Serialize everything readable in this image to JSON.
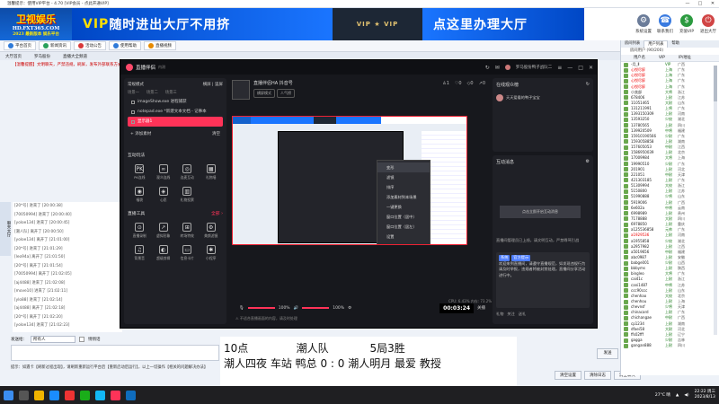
{
  "window": {
    "title": "温馨提示：使用VIP平台 - 4.70 [VIP会员 - 点此开通VIP]",
    "controls": [
      "—",
      "□",
      "✕"
    ]
  },
  "banner": {
    "logo": {
      "l1": "卫视娱乐",
      "l2": "HD.FXT365.COM",
      "l3": "2023 最新版本 娱乐平台"
    },
    "ad1": {
      "pre": "VIP",
      "text": "随时进出大厅不用挤"
    },
    "ad2": {
      "text": "VIP ★ VIP"
    },
    "ad3": {
      "pre": "",
      "text": "点这里办理大厅"
    },
    "icons": [
      {
        "label": "系统设置",
        "color": "#6b7c99",
        "glyph": "⚙"
      },
      {
        "label": "联系我们",
        "color": "#3a7be0",
        "glyph": "☎"
      },
      {
        "label": "充值VIP",
        "color": "#2b9a3f",
        "glyph": "$"
      },
      {
        "label": "退出大厅",
        "color": "#d14545",
        "glyph": "⏻"
      }
    ]
  },
  "toolbar": {
    "items": [
      {
        "label": "平台首页",
        "color": "#2f7ad8"
      },
      {
        "label": "新闻资讯",
        "color": "#2aa05a"
      },
      {
        "label": "活动公告",
        "color": "#d83a3a"
      },
      {
        "label": "使用帮助",
        "color": "#2f7ad8"
      },
      {
        "label": "直播视频",
        "color": "#e68a00"
      }
    ]
  },
  "crumb": {
    "items": [
      "大厅首页",
      "罗马股份",
      "直播大全频道"
    ]
  },
  "notice": "【温馨提醒】文明聊天，严禁违规，刷屏，发布外部联系方式违者封号",
  "lefttab": "聊天大厅",
  "chatlog": [
    "[20*号] 进来了 [20:00:38]",
    "[70050994] 进来了 [20:00:40]",
    "[yoloe134] 进来了 [20:00:45]",
    "[潮人队] 离开了 [20:00:50]",
    "[yoloe134] 离开了 [21:01:00]",
    "[20*号] 进来了 [21:01:29]",
    "[leo94a] 离开了 [21:01:50]",
    "[20*号] 离开了 [21:01:54]",
    "[70050994] 离开了 [21:02:05]",
    "[aj4488] 进来了 [21:02:08]",
    "[move10] 进来了 [21:02:11]",
    "[ylo88] 进来了 [21:02:14]",
    "[aj4488] 离开了 [21:02:18]",
    "[20*号] 离开了 [21:02:20]",
    "[yoloe134] 进来了 [21:02:23]"
  ],
  "input": {
    "label": "发送给：",
    "target": "所有人",
    "checkbox": "悄悄话",
    "send": "发送"
  },
  "tip": "提示：如遇卡【刷新过程出现】，请刷新重新运行平台后【重新启动后运行】，以上一切操作【相关的问题解决办法】",
  "overlay": {
    "line1": "10点              潮人队            5局3胜",
    "line2": "潮人四夜 车站 鸭总 0 : 0 潮人明月 最爱 教授"
  },
  "rightbuttons": [
    "清空设置",
    "清除日志",
    "清空聊天"
  ],
  "rpanel": {
    "tabs": [
      "房间列表",
      "用户列表",
      "帮助"
    ],
    "active": 1,
    "sub": "房间用户 (90/200)",
    "headers": [
      "用户名",
      "VIP",
      "IP/地址"
    ],
    "users": [
      {
        "n": "-月_Ⅱ",
        "r": "VIP",
        "ip": "广西",
        "red": false
      },
      {
        "n": "心悦尽醉",
        "r": "上海",
        "ip": "广东",
        "red": true
      },
      {
        "n": "心悦尽醉",
        "r": "上海",
        "ip": "广东",
        "red": true
      },
      {
        "n": "心悦尽醉",
        "r": "上海",
        "ip": "广东",
        "red": true
      },
      {
        "n": "心悦尽醉",
        "r": "上海",
        "ip": "广东",
        "red": true
      },
      {
        "n": "小卖部",
        "r": "大将",
        "ip": "浙江",
        "red": false
      },
      {
        "n": "678406",
        "r": "上尉",
        "ip": "江苏",
        "red": false
      },
      {
        "n": "11051465",
        "r": "大尉",
        "ip": "山东",
        "red": false
      },
      {
        "n": "131211991",
        "r": "上将",
        "ip": "广东",
        "red": false
      },
      {
        "n": "1393150309",
        "r": "上尉",
        "ip": "河南",
        "red": false
      },
      {
        "n": "13593250",
        "r": "少校",
        "ip": "湖北",
        "red": false
      },
      {
        "n": "13780565",
        "r": "上尉",
        "ip": "四川",
        "red": false
      },
      {
        "n": "139920509",
        "r": "中将",
        "ip": "福建",
        "red": false
      },
      {
        "n": "15910190566",
        "r": "少尉",
        "ip": "广东",
        "red": false
      },
      {
        "n": "1593058858",
        "r": "上尉",
        "ip": "湖南",
        "red": false
      },
      {
        "n": "157605053",
        "r": "中尉",
        "ip": "江西",
        "red": false
      },
      {
        "n": "1586950039",
        "r": "上尉",
        "ip": "北京",
        "red": false
      },
      {
        "n": "17009984",
        "r": "大将",
        "ip": "上海",
        "red": false
      },
      {
        "n": "19990510",
        "r": "少尉",
        "ip": "广东",
        "red": false
      },
      {
        "n": "201901",
        "r": "上尉",
        "ip": "河北",
        "red": false
      },
      {
        "n": "221051",
        "r": "中尉",
        "ip": "天津",
        "red": false
      },
      {
        "n": "421303185",
        "r": "上尉",
        "ip": "广东",
        "red": false
      },
      {
        "n": "51309994",
        "r": "大校",
        "ip": "浙江",
        "red": false
      },
      {
        "n": "5150800",
        "r": "上尉",
        "ip": "江苏",
        "red": false
      },
      {
        "n": "51990888",
        "r": "少将",
        "ip": "山东",
        "red": false
      },
      {
        "n": "5919006",
        "r": "上尉",
        "ip": "广西",
        "red": false
      },
      {
        "n": "6e602a",
        "r": "中将",
        "ip": "云南",
        "red": false
      },
      {
        "n": "6998989",
        "r": "上尉",
        "ip": "贵州",
        "red": false
      },
      {
        "n": "7178888",
        "r": "大尉",
        "ip": "四川",
        "red": false
      },
      {
        "n": "6978850",
        "r": "上尉",
        "ip": "重庆",
        "red": false
      },
      {
        "n": "a125536858",
        "r": "元帅",
        "ip": "广东",
        "red": false
      },
      {
        "n": "a1929536",
        "r": "上尉",
        "ip": "河南",
        "red": true
      },
      {
        "n": "a1955858",
        "r": "少校",
        "ip": "湖北",
        "red": false
      },
      {
        "n": "a2957982",
        "r": "上尉",
        "ip": "江西",
        "red": false
      },
      {
        "n": "a5019656",
        "r": "中尉",
        "ip": "福建",
        "red": false
      },
      {
        "n": "abc0987",
        "r": "上尉",
        "ip": "安徽",
        "red": false
      },
      {
        "n": "babge001",
        "r": "少尉",
        "ip": "山西",
        "red": false
      },
      {
        "n": "bbbyms",
        "r": "上尉",
        "ip": "陕西",
        "red": false
      },
      {
        "n": "bingleo",
        "r": "大将",
        "ip": "广东",
        "red": false
      },
      {
        "n": "cai41c",
        "r": "上尉",
        "ip": "浙江",
        "red": false
      },
      {
        "n": "cani1487",
        "r": "中将",
        "ip": "江苏",
        "red": false
      },
      {
        "n": "ccc90ccc",
        "r": "上尉",
        "ip": "山东",
        "red": false
      },
      {
        "n": "chenhao",
        "r": "大校",
        "ip": "北京",
        "red": false
      },
      {
        "n": "chenhou",
        "r": "上尉",
        "ip": "上海",
        "red": false
      },
      {
        "n": "chevnsf",
        "r": "少将",
        "ip": "天津",
        "red": false
      },
      {
        "n": "chinacard",
        "r": "上尉",
        "ip": "广东",
        "red": false
      },
      {
        "n": "chichangae",
        "r": "中尉",
        "ip": "广西",
        "red": false
      },
      {
        "n": "cp1234",
        "r": "上尉",
        "ip": "湖南",
        "red": false
      },
      {
        "n": "dfaei58",
        "r": "大尉",
        "ip": "河北",
        "red": false
      },
      {
        "n": "ffs02fff",
        "r": "上尉",
        "ip": "辽宁",
        "red": false
      },
      {
        "n": "gagga",
        "r": "少尉",
        "ip": "吉林",
        "red": false
      },
      {
        "n": "gangan888",
        "r": "上尉",
        "ip": "四川",
        "red": false
      }
    ]
  },
  "obs": {
    "appname": "直播伴侣",
    "badge": "内测",
    "user": "罗马股份鸭子战队二",
    "mode": "常规模式",
    "scenes": [
      "横屏",
      "竖屏"
    ],
    "layerTabs": [
      "场景一",
      "场景二",
      "场景三"
    ],
    "sources": [
      {
        "label": "imageShow.exe 进程捕获",
        "on": false
      },
      {
        "label": "notepad.exe *新建文本文档 - 记事本",
        "on": false
      },
      {
        "label": "显示器1",
        "on": true
      }
    ],
    "addsource": "+ 添加素材",
    "clear": "清空",
    "interactTitle": "互动玩法",
    "interact": [
      {
        "g": "PK",
        "t": "PK连线"
      },
      {
        "g": "∞",
        "t": "观众连线"
      },
      {
        "g": "◎",
        "t": "连麦互动"
      },
      {
        "g": "▦",
        "t": "礼物墙"
      },
      {
        "g": "◉",
        "t": "福袋"
      },
      {
        "g": "◈",
        "t": "心愿"
      },
      {
        "g": "▥",
        "t": "礼物投票"
      },
      {
        "g": "",
        "t": ""
      }
    ],
    "toolsTitle": "直播工具",
    "toolsMore": "全部 ›",
    "tools": [
      {
        "g": "⊙",
        "t": "直播录制"
      },
      {
        "g": "↗",
        "t": "虚拟形象"
      },
      {
        "g": "⊞",
        "t": "转场特效"
      },
      {
        "g": "⚙",
        "t": "美颜滤镜"
      },
      {
        "g": "♫",
        "t": "背景音"
      },
      {
        "g": "◐",
        "t": "超级剪辑"
      },
      {
        "g": "▭",
        "t": "信息卡片"
      },
      {
        "g": "✱",
        "t": "小程序"
      }
    ],
    "scene": {
      "title": "直播伴侣HA 抖音号",
      "pill1": "横屏模式",
      "pill2": "人气榜"
    },
    "stats": {
      "a": "1",
      "b": "0",
      "c": "0",
      "d": "0"
    },
    "context": [
      "变形",
      "滤镜",
      "排序",
      "添加素材到本场景",
      "一键更换",
      "窗口位置（居中）",
      "窗口位置（居左）",
      "设置",
      "删除"
    ],
    "vol1": "100%",
    "vol2": "100%",
    "time": "00:03:24",
    "timeLabel": "关播",
    "warn": "⚠ 不适合直播画面的内容，请及时处理",
    "status": "CPU: 6.43%  内存: 73.2%  帧率：30  码率：4815 kbps  丢帧：0  网络：",
    "statusRed": "直播中 00:03:24",
    "rightTop": {
      "title": "在线观众榜",
      "user": "天天爱看的鸭子宝宝"
    },
    "chat": {
      "title": "互动消息",
      "fake": "点击立即开启互动消息",
      "msgs": "直播间管理员已上线，请文明互动，严禁辱骂引战",
      "tag1": "系统",
      "tag2": "官方提示",
      "bubble": "欢迎来到直播间，请遵守直播规范，如发现违规行为请及时举报，违规者将被封禁处理。直播间分享活动进行中。",
      "actions": [
        "礼物",
        "关注",
        "送礼"
      ]
    }
  },
  "taskbar": {
    "weather": "27°C 晴",
    "time": "22:22 周三",
    "date": "2023/8/13"
  }
}
